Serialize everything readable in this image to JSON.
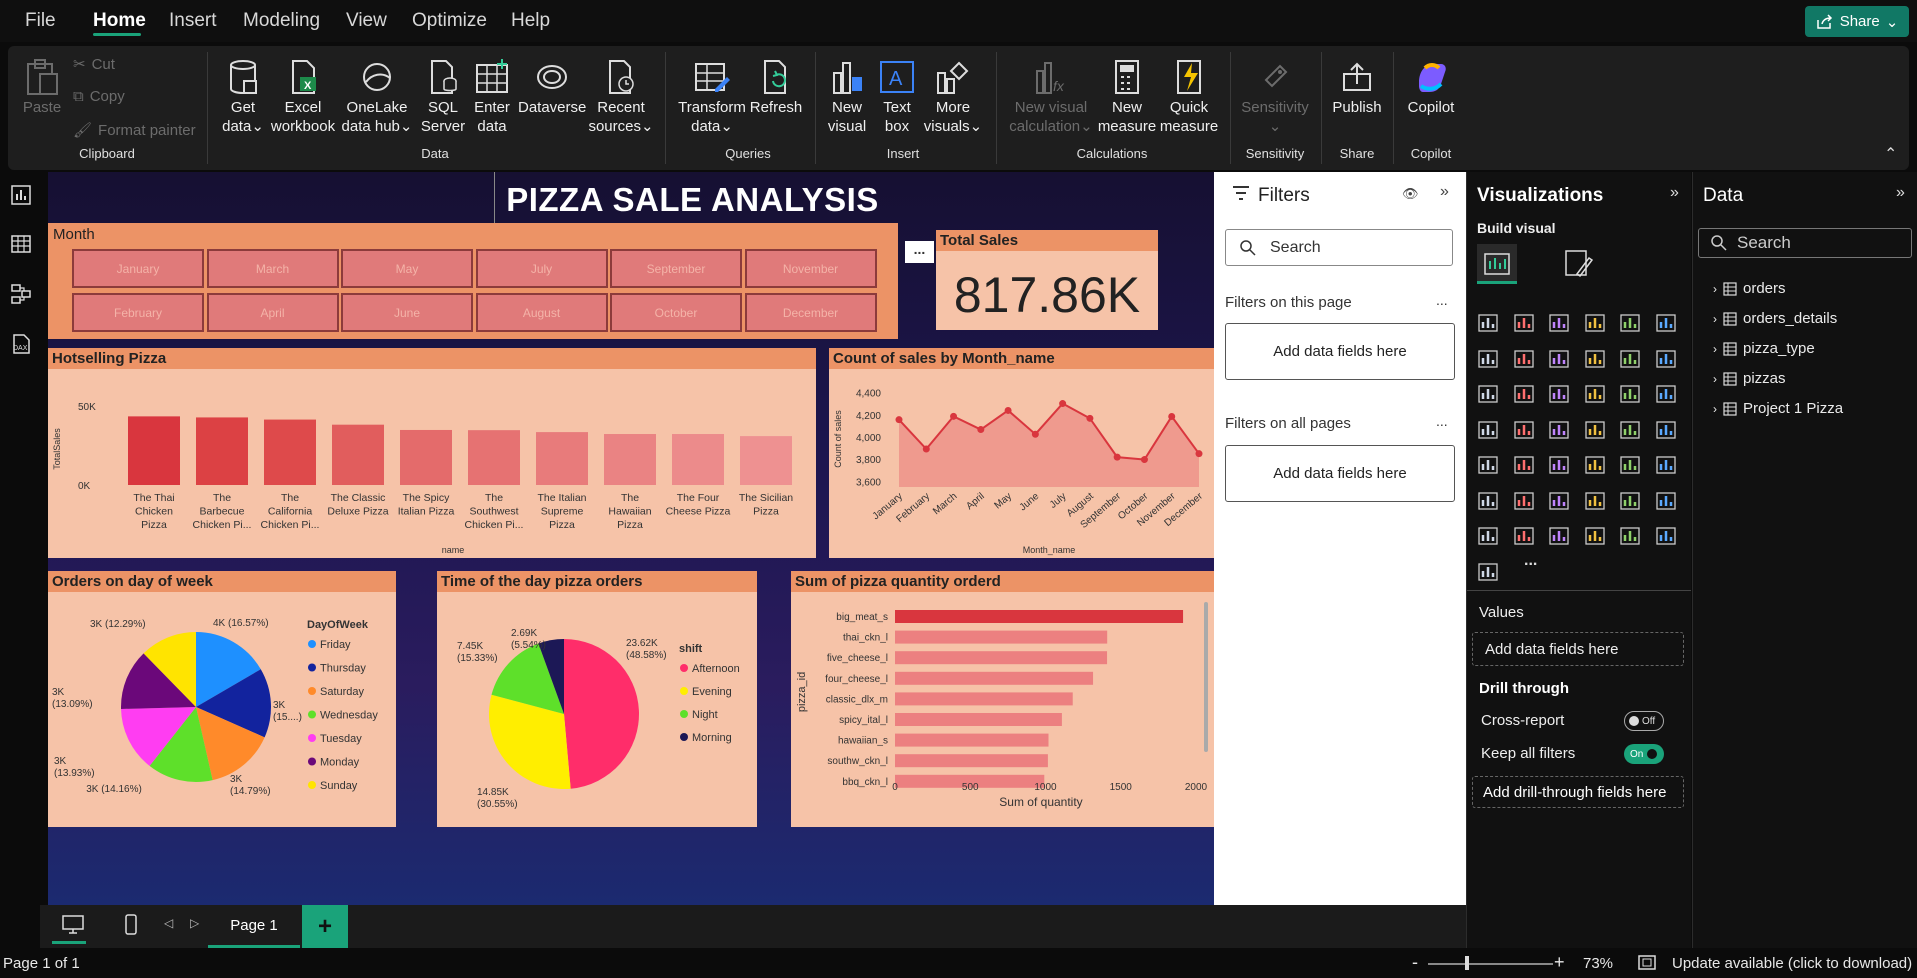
{
  "menubar": {
    "items": [
      "File",
      "Home",
      "Insert",
      "Modeling",
      "View",
      "Optimize",
      "Help"
    ],
    "share": "Share"
  },
  "ribbon": {
    "clipboard": {
      "paste": "Paste",
      "cut": "Cut",
      "copy": "Copy",
      "format_painter": "Format painter",
      "group": "Clipboard"
    },
    "data": {
      "get_data": [
        "Get",
        "data"
      ],
      "excel": [
        "Excel",
        "workbook"
      ],
      "onelake": [
        "OneLake",
        "data hub"
      ],
      "sql": [
        "SQL",
        "Server"
      ],
      "enter": [
        "Enter",
        "data"
      ],
      "dataverse": "Dataverse",
      "recent": [
        "Recent",
        "sources"
      ],
      "group": "Data"
    },
    "queries": {
      "transform": [
        "Transform",
        "data"
      ],
      "refresh": "Refresh",
      "group": "Queries"
    },
    "insert": {
      "new_visual": [
        "New",
        "visual"
      ],
      "text_box": [
        "Text",
        "box"
      ],
      "more_visuals": [
        "More",
        "visuals"
      ],
      "group": "Insert"
    },
    "calculations": {
      "new_visual_calc": [
        "New visual",
        "calculation"
      ],
      "new_measure": [
        "New",
        "measure"
      ],
      "quick_measure": [
        "Quick",
        "measure"
      ],
      "group": "Calculations"
    },
    "sensitivity": {
      "label": "Sensitivity",
      "group": "Sensitivity"
    },
    "share": {
      "publish": "Publish",
      "group": "Share"
    },
    "copilot": {
      "label": "Copilot",
      "group": "Copilot"
    }
  },
  "report": {
    "title": "PIZZA SALE ANALYSIS",
    "month_slicer": {
      "title": "Month",
      "months": [
        "January",
        "March",
        "May",
        "July",
        "September",
        "November",
        "February",
        "April",
        "June",
        "August",
        "October",
        "December"
      ]
    },
    "total_sales": {
      "title": "Total Sales",
      "value": "817.86K"
    },
    "more_options": "...",
    "hotselling_title": "Hotselling Pizza",
    "count_title": "Count of sales by Month_name",
    "orders_dow_title": "Orders on day of week",
    "time_of_day_title": "Time of the day pizza orders",
    "sum_qty_title": "Sum of pizza quantity orderd"
  },
  "chart_data": [
    {
      "type": "bar",
      "title": "Hotselling Pizza",
      "xlabel": "name",
      "ylabel": "TotalSales",
      "categories": [
        "The Thai Chicken Pizza",
        "The Barbecue Chicken Pi...",
        "The California Chicken Pi...",
        "The Classic Deluxe Pizza",
        "The Spicy Italian Pizza",
        "The Southwest Chicken Pi...",
        "The Italian Supreme Pizza",
        "The Hawaiian Pizza",
        "The Four Cheese Pizza",
        "The Sicilian Pizza"
      ],
      "category_lines": [
        [
          "The Thai",
          "Chicken",
          "Pizza"
        ],
        [
          "The",
          "Barbecue",
          "Chicken Pi..."
        ],
        [
          "The",
          "California",
          "Chicken Pi..."
        ],
        [
          "The Classic",
          "Deluxe Pizza"
        ],
        [
          "The Spicy",
          "Italian Pizza"
        ],
        [
          "The",
          "Southwest",
          "Chicken Pi..."
        ],
        [
          "The Italian",
          "Supreme",
          "Pizza"
        ],
        [
          "The",
          "Hawaiian",
          "Pizza"
        ],
        [
          "The Four",
          "Cheese Pizza"
        ],
        [
          "The Sicilian",
          "Pizza"
        ]
      ],
      "values": [
        43434,
        42768,
        41410,
        38181,
        34831,
        34706,
        33477,
        32273,
        32266,
        30941
      ],
      "yticks": [
        "50K",
        "0K"
      ],
      "ylim": [
        0,
        50000
      ]
    },
    {
      "type": "area",
      "title": "Count of sales by Month_name",
      "xlabel": "Month_name",
      "ylabel": "Count of sales",
      "categories": [
        "January",
        "February",
        "March",
        "April",
        "May",
        "June",
        "July",
        "August",
        "September",
        "October",
        "November",
        "December"
      ],
      "values": [
        4156,
        3892,
        4186,
        4067,
        4239,
        4025,
        4301,
        4168,
        3819,
        3797,
        4185,
        3850
      ],
      "yticks": [
        4400,
        4200,
        4000,
        3800,
        3600
      ],
      "ylim": [
        3550,
        4450
      ]
    },
    {
      "type": "pie",
      "title": "Orders on day of week",
      "legend_title": "DayOfWeek",
      "slices": [
        {
          "name": "Friday",
          "value": 16.57,
          "label": "4K (16.57%)",
          "color": "#1e90ff"
        },
        {
          "name": "Thursday",
          "value": 15.0,
          "label": "3K (15....)",
          "color": "#12239e"
        },
        {
          "name": "Saturday",
          "value": 14.79,
          "label": "3K (14.79%)",
          "color": "#ff8a2a"
        },
        {
          "name": "Wednesday",
          "value": 14.16,
          "label": "3K (14.16%)",
          "color": "#5ee02a"
        },
        {
          "name": "Tuesday",
          "value": 13.93,
          "label": "3K (13.93%)",
          "color": "#ff3df2"
        },
        {
          "name": "Monday",
          "value": 13.09,
          "label": "3K (13.09%)",
          "color": "#6b087a"
        },
        {
          "name": "Sunday",
          "value": 12.29,
          "label": "3K (12.29%)",
          "color": "#ffe400"
        }
      ]
    },
    {
      "type": "pie",
      "title": "Time of the day pizza orders",
      "legend_title": "shift",
      "slices": [
        {
          "name": "Afternoon",
          "value": 48.58,
          "label": "23.62K (48.58%)",
          "color": "#ff2d6a"
        },
        {
          "name": "Evening",
          "value": 30.55,
          "label": "14.85K (30.55%)",
          "color": "#ffee00"
        },
        {
          "name": "Night",
          "value": 15.33,
          "label": "7.45K (15.33%)",
          "color": "#5ee02a"
        },
        {
          "name": "Morning",
          "value": 5.54,
          "label": "2.69K (5.54%)",
          "color": "#1c1856"
        }
      ]
    },
    {
      "type": "bar",
      "orientation": "horizontal",
      "title": "Sum of pizza quantity orderd",
      "xlabel": "Sum of quantity",
      "ylabel": "pizza_id",
      "categories": [
        "big_meat_s",
        "thai_ckn_l",
        "five_cheese_l",
        "four_cheese_l",
        "classic_dlx_m",
        "spicy_ital_l",
        "hawaiian_s",
        "southw_ckn_l",
        "bbq_ckn_l"
      ],
      "values": [
        1914,
        1410,
        1409,
        1316,
        1181,
        1109,
        1020,
        1016,
        992
      ],
      "xticks": [
        0,
        500,
        1000,
        1500,
        2000
      ],
      "xlim": [
        0,
        2000
      ]
    }
  ],
  "filters": {
    "title": "Filters",
    "search": "Search",
    "on_page": "Filters on this page",
    "on_all": "Filters on all pages",
    "add": "Add data fields here",
    "dots": "..."
  },
  "visualizations": {
    "title": "Visualizations",
    "build": "Build visual",
    "values": "Values",
    "add_values": "Add data fields here",
    "drill": "Drill through",
    "cross_report": "Cross-report",
    "cross_state": "Off",
    "keep_filters": "Keep all filters",
    "keep_state": "On",
    "add_drill": "Add drill-through fields here",
    "more": "..."
  },
  "data_pane": {
    "title": "Data",
    "search": "Search",
    "tables": [
      "orders",
      "orders_details",
      "pizza_type",
      "pizzas",
      "Project 1 Pizza"
    ]
  },
  "pagebar": {
    "page": "Page 1",
    "add": "+"
  },
  "status": {
    "page": "Page 1 of 1",
    "zoom": "73%",
    "update": "Update available (click to download)",
    "minus": "-",
    "plus": "+"
  },
  "colors": {
    "accent": "#117865",
    "card": "#f6c3a8",
    "header": "#ec9366",
    "bar_top": "#d9363e",
    "bar_light": "#ef8c8c"
  }
}
